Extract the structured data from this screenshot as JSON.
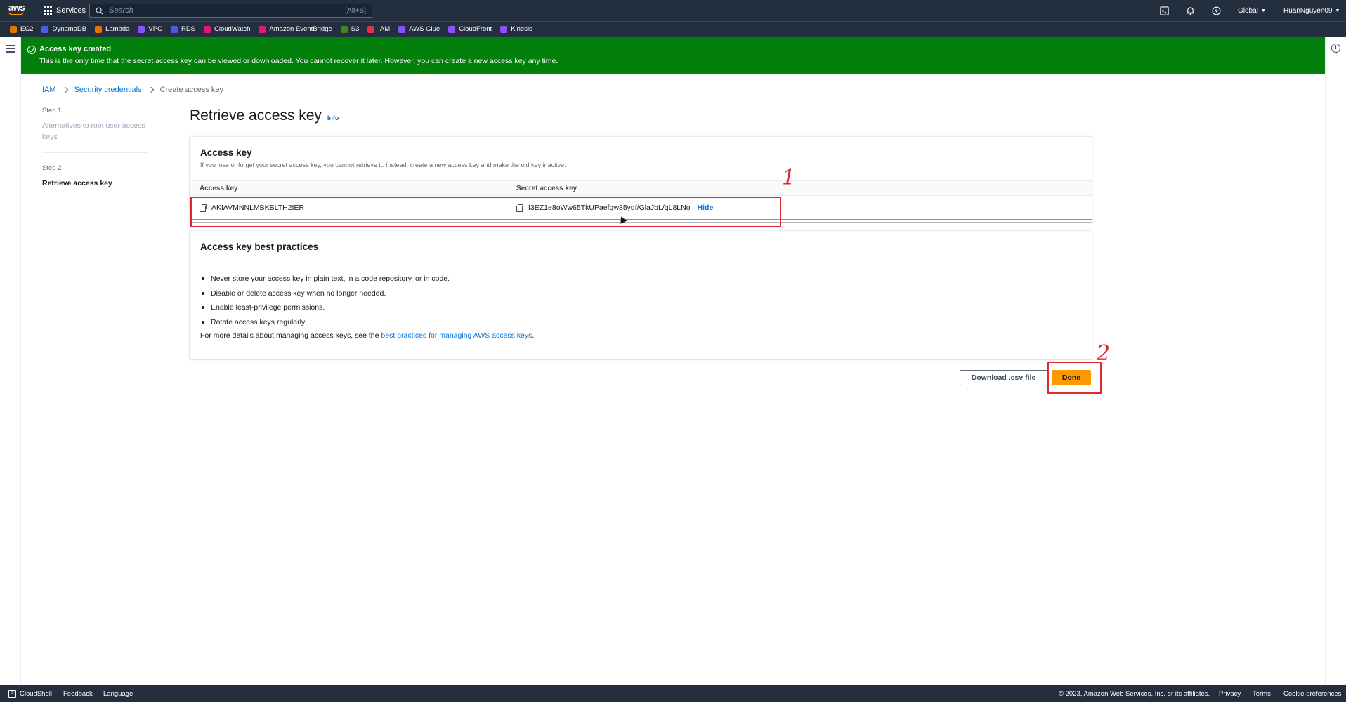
{
  "topnav": {
    "logo_text": "aws",
    "services_label": "Services",
    "search_placeholder": "Search",
    "search_shortcut": "[Alt+S]",
    "region_label": "Global",
    "user_label": "HuanNguyen09"
  },
  "favorites": [
    {
      "label": "EC2",
      "color": "#ed7100"
    },
    {
      "label": "DynamoDB",
      "color": "#4d5be8"
    },
    {
      "label": "Lambda",
      "color": "#ed7100"
    },
    {
      "label": "VPC",
      "color": "#8c4fff"
    },
    {
      "label": "RDS",
      "color": "#4d5be8"
    },
    {
      "label": "CloudWatch",
      "color": "#e7157b"
    },
    {
      "label": "Amazon EventBridge",
      "color": "#e7157b"
    },
    {
      "label": "S3",
      "color": "#3f8624"
    },
    {
      "label": "IAM",
      "color": "#dd344c"
    },
    {
      "label": "AWS Glue",
      "color": "#8c4fff"
    },
    {
      "label": "CloudFront",
      "color": "#8c4fff"
    },
    {
      "label": "Kinesis",
      "color": "#8c4fff"
    }
  ],
  "flash": {
    "title": "Access key created",
    "message": "This is the only time that the secret access key can be viewed or downloaded. You cannot recover it later. However, you can create a new access key any time."
  },
  "breadcrumb": {
    "items": [
      "IAM",
      "Security credentials"
    ],
    "current": "Create access key"
  },
  "steps": [
    {
      "label": "Step 1",
      "desc": "Alternatives to root user access keys"
    },
    {
      "label": "Step 2",
      "desc": "Retrieve access key"
    }
  ],
  "page": {
    "title": "Retrieve access key",
    "info_label": "Info"
  },
  "access_key_panel": {
    "title": "Access key",
    "description": "If you lose or forget your secret access key, you cannot retrieve it. Instead, create a new access key and make the old key inactive.",
    "col_access_key": "Access key",
    "col_secret_key": "Secret access key",
    "access_key_value": "AKIAVMNNLMBKBLTH2IER",
    "secret_key_value": "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",
    "hide_label": "Hide"
  },
  "practices_panel": {
    "title": "Access key best practices",
    "items": [
      "Never store your access key in plain text, in a code repository, or in code.",
      "Disable or delete access key when no longer needed.",
      "Enable least-privilege permissions.",
      "Rotate access keys regularly."
    ],
    "more_prefix": "For more details about managing access keys, see the ",
    "more_link": "best practices for managing AWS access keys",
    "more_suffix": "."
  },
  "actions": {
    "download_label": "Download .csv file",
    "done_label": "Done"
  },
  "annotations": {
    "num1": "1",
    "num2": "2",
    "color": "#e0262f"
  },
  "footer": {
    "cloudshell": "CloudShell",
    "feedback": "Feedback",
    "language": "Language",
    "copyright": "© 2023, Amazon Web Services, Inc. or its affiliates.",
    "privacy": "Privacy",
    "terms": "Terms",
    "cookies": "Cookie preferences"
  }
}
